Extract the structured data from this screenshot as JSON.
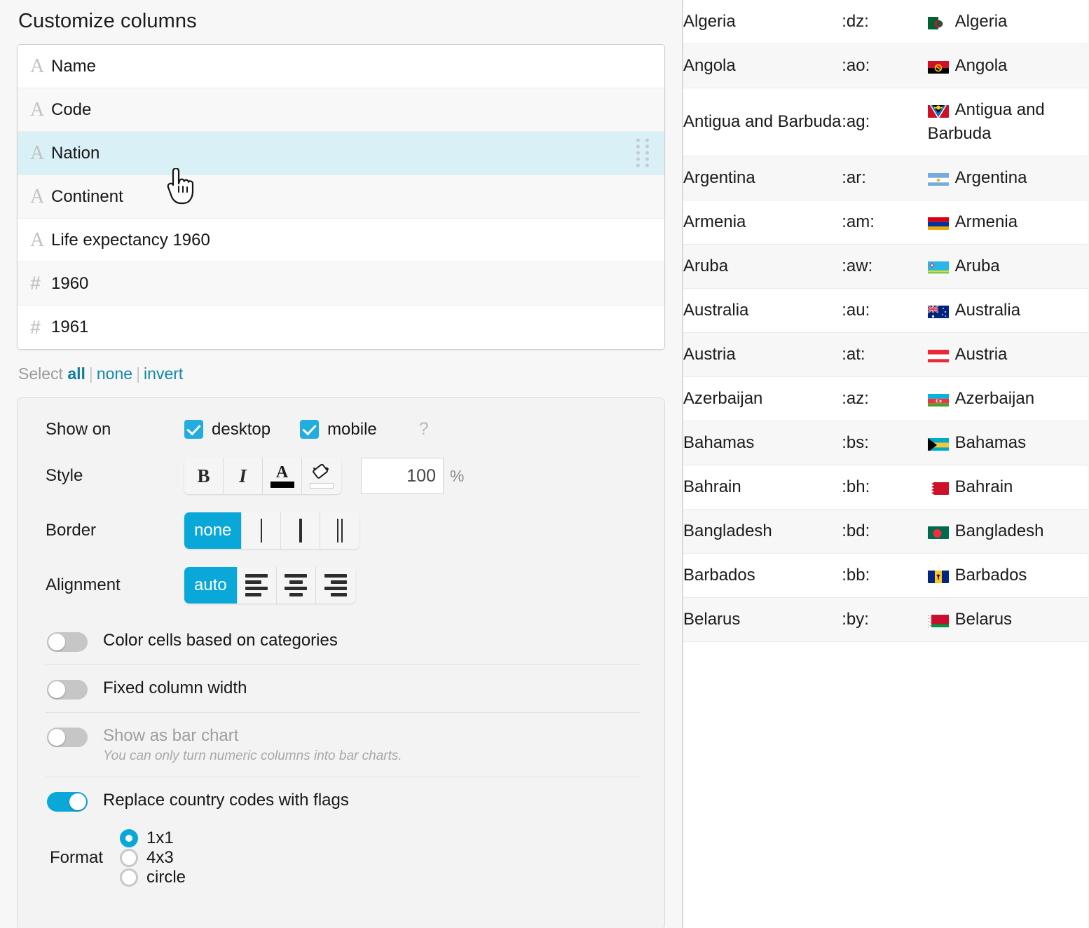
{
  "panel": {
    "title": "Customize columns",
    "columns": [
      {
        "type": "text",
        "icon": "text-type-icon",
        "label": "Name",
        "selected": false
      },
      {
        "type": "text",
        "icon": "text-type-icon",
        "label": "Code",
        "selected": false
      },
      {
        "type": "text",
        "icon": "text-type-icon",
        "label": "Nation",
        "selected": true
      },
      {
        "type": "text",
        "icon": "text-type-icon",
        "label": "Continent",
        "selected": false
      },
      {
        "type": "text",
        "icon": "text-type-icon",
        "label": "Life expectancy 1960",
        "selected": false
      },
      {
        "type": "number",
        "icon": "number-type-icon",
        "label": "1960",
        "selected": false
      },
      {
        "type": "number",
        "icon": "number-type-icon",
        "label": "1961",
        "selected": false
      }
    ],
    "select_links": {
      "prefix": "Select",
      "all": "all",
      "none": "none",
      "invert": "invert",
      "separator": "|"
    }
  },
  "settings": {
    "show_on": {
      "label": "Show on",
      "desktop": {
        "label": "desktop",
        "checked": true
      },
      "mobile": {
        "label": "mobile",
        "checked": true
      },
      "help": "?"
    },
    "style": {
      "label": "Style",
      "bold": "B",
      "italic": "I",
      "text_color": "A",
      "fill_color": "paint-bucket",
      "opacity_value": "100",
      "opacity_unit": "%"
    },
    "border": {
      "label": "Border",
      "options": [
        "none",
        "thin",
        "thick",
        "double"
      ],
      "selected": "none"
    },
    "alignment": {
      "label": "Alignment",
      "options": [
        "auto",
        "left",
        "center",
        "right"
      ],
      "selected": "auto"
    },
    "toggles": [
      {
        "label": "Color cells based on categories",
        "on": false,
        "disabled": false,
        "hint": ""
      },
      {
        "label": "Fixed column width",
        "on": false,
        "disabled": false,
        "hint": ""
      },
      {
        "label": "Show as bar chart",
        "on": false,
        "disabled": true,
        "hint": "You can only turn numeric columns into bar charts."
      },
      {
        "label": "Replace country codes with flags",
        "on": true,
        "disabled": false,
        "hint": ""
      }
    ],
    "format": {
      "label": "Format",
      "options": [
        {
          "label": "1x1",
          "selected": true
        },
        {
          "label": "4x3",
          "selected": false
        },
        {
          "label": "circle",
          "selected": false
        }
      ]
    }
  },
  "colors": {
    "accent": "#0aa7d9",
    "checkbox": "#22ace0",
    "link": "#1287a8",
    "selected_row": "#d9f0f7"
  },
  "table": {
    "rows": [
      {
        "name": "Algeria",
        "code": ":dz:",
        "flag_label": "Algeria",
        "flag": "dz"
      },
      {
        "name": "Angola",
        "code": ":ao:",
        "flag_label": "Angola",
        "flag": "ao"
      },
      {
        "name": "Antigua and Barbuda",
        "code": ":ag:",
        "flag_label": "Antigua and Barbuda",
        "flag": "ag"
      },
      {
        "name": "Argentina",
        "code": ":ar:",
        "flag_label": "Argentina",
        "flag": "ar"
      },
      {
        "name": "Armenia",
        "code": ":am:",
        "flag_label": "Armenia",
        "flag": "am"
      },
      {
        "name": "Aruba",
        "code": ":aw:",
        "flag_label": "Aruba",
        "flag": "aw"
      },
      {
        "name": "Australia",
        "code": ":au:",
        "flag_label": "Australia",
        "flag": "au"
      },
      {
        "name": "Austria",
        "code": ":at:",
        "flag_label": "Austria",
        "flag": "at"
      },
      {
        "name": "Azerbaijan",
        "code": ":az:",
        "flag_label": "Azerbaijan",
        "flag": "az"
      },
      {
        "name": "Bahamas",
        "code": ":bs:",
        "flag_label": "Bahamas",
        "flag": "bs"
      },
      {
        "name": "Bahrain",
        "code": ":bh:",
        "flag_label": "Bahrain",
        "flag": "bh"
      },
      {
        "name": "Bangladesh",
        "code": ":bd:",
        "flag_label": "Bangladesh",
        "flag": "bd"
      },
      {
        "name": "Barbados",
        "code": ":bb:",
        "flag_label": "Barbados",
        "flag": "bb"
      },
      {
        "name": "Belarus",
        "code": ":by:",
        "flag_label": "Belarus",
        "flag": "by"
      }
    ]
  }
}
